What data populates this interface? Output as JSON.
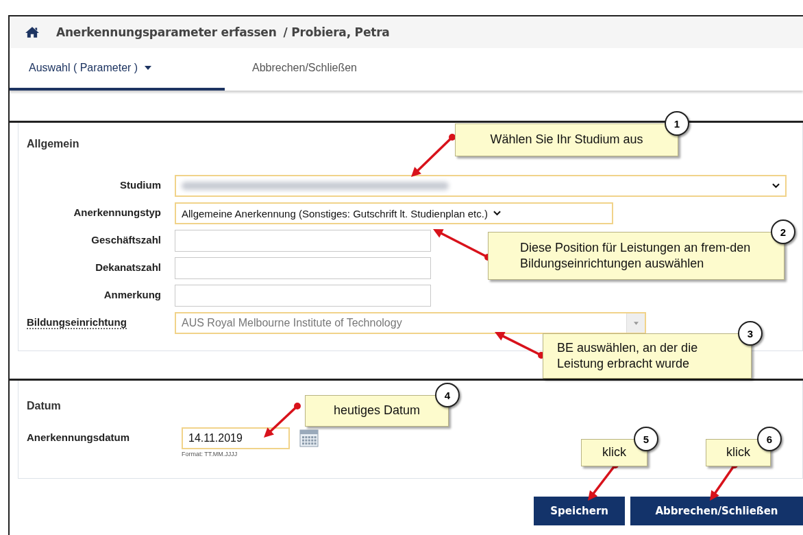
{
  "header": {
    "title": "Anerkennungsparameter erfassen",
    "subtitle": "/ Probiera, Petra"
  },
  "tabs": [
    {
      "label": "Auswahl ( Parameter )",
      "selected": true,
      "dropdown": true
    },
    {
      "label": "Abbrechen/Schließen",
      "selected": false
    }
  ],
  "sections": [
    {
      "title": "Allgemein",
      "fields": [
        {
          "label": "Studium",
          "kind": "select",
          "value_blurred": true,
          "highlighted": true
        },
        {
          "label": "Anerkennungstyp",
          "kind": "select-short",
          "value": "Allgemeine Anerkennung (Sonstiges: Gutschrift lt. Studienplan etc.)",
          "highlighted": true
        },
        {
          "label": "Geschäftszahl",
          "kind": "text",
          "highlighted": false
        },
        {
          "label": "Dekanatszahl",
          "kind": "text",
          "highlighted": false
        },
        {
          "label": "Anmerkung",
          "kind": "text",
          "highlighted": false
        },
        {
          "label": "Bildungseinrichtung",
          "kind": "combo",
          "value": "AUS Royal Melbourne Institute of Technology",
          "highlighted": true,
          "help": true
        }
      ]
    },
    {
      "title": "Datum",
      "fields": [
        {
          "label": "Anerkennungsdatum",
          "kind": "date",
          "value": "14.11.2019",
          "hint": "Format: TT.MM.JJJJ",
          "highlighted": true
        }
      ]
    }
  ],
  "callouts": [
    {
      "number": "1",
      "text": "Wählen Sie Ihr Studium aus"
    },
    {
      "number": "2",
      "text": "Diese Position für Leistungen an frem-den Bildungseinrichtungen auswählen"
    },
    {
      "number": "3",
      "text": "BE auswählen, an der die Leistung erbracht wurde"
    },
    {
      "number": "4",
      "text": "heutiges Datum"
    },
    {
      "number": "5",
      "text": "klick"
    },
    {
      "number": "6",
      "text": "klick"
    }
  ],
  "buttons": [
    "Speichern",
    "Abbrechen/Schließen"
  ]
}
